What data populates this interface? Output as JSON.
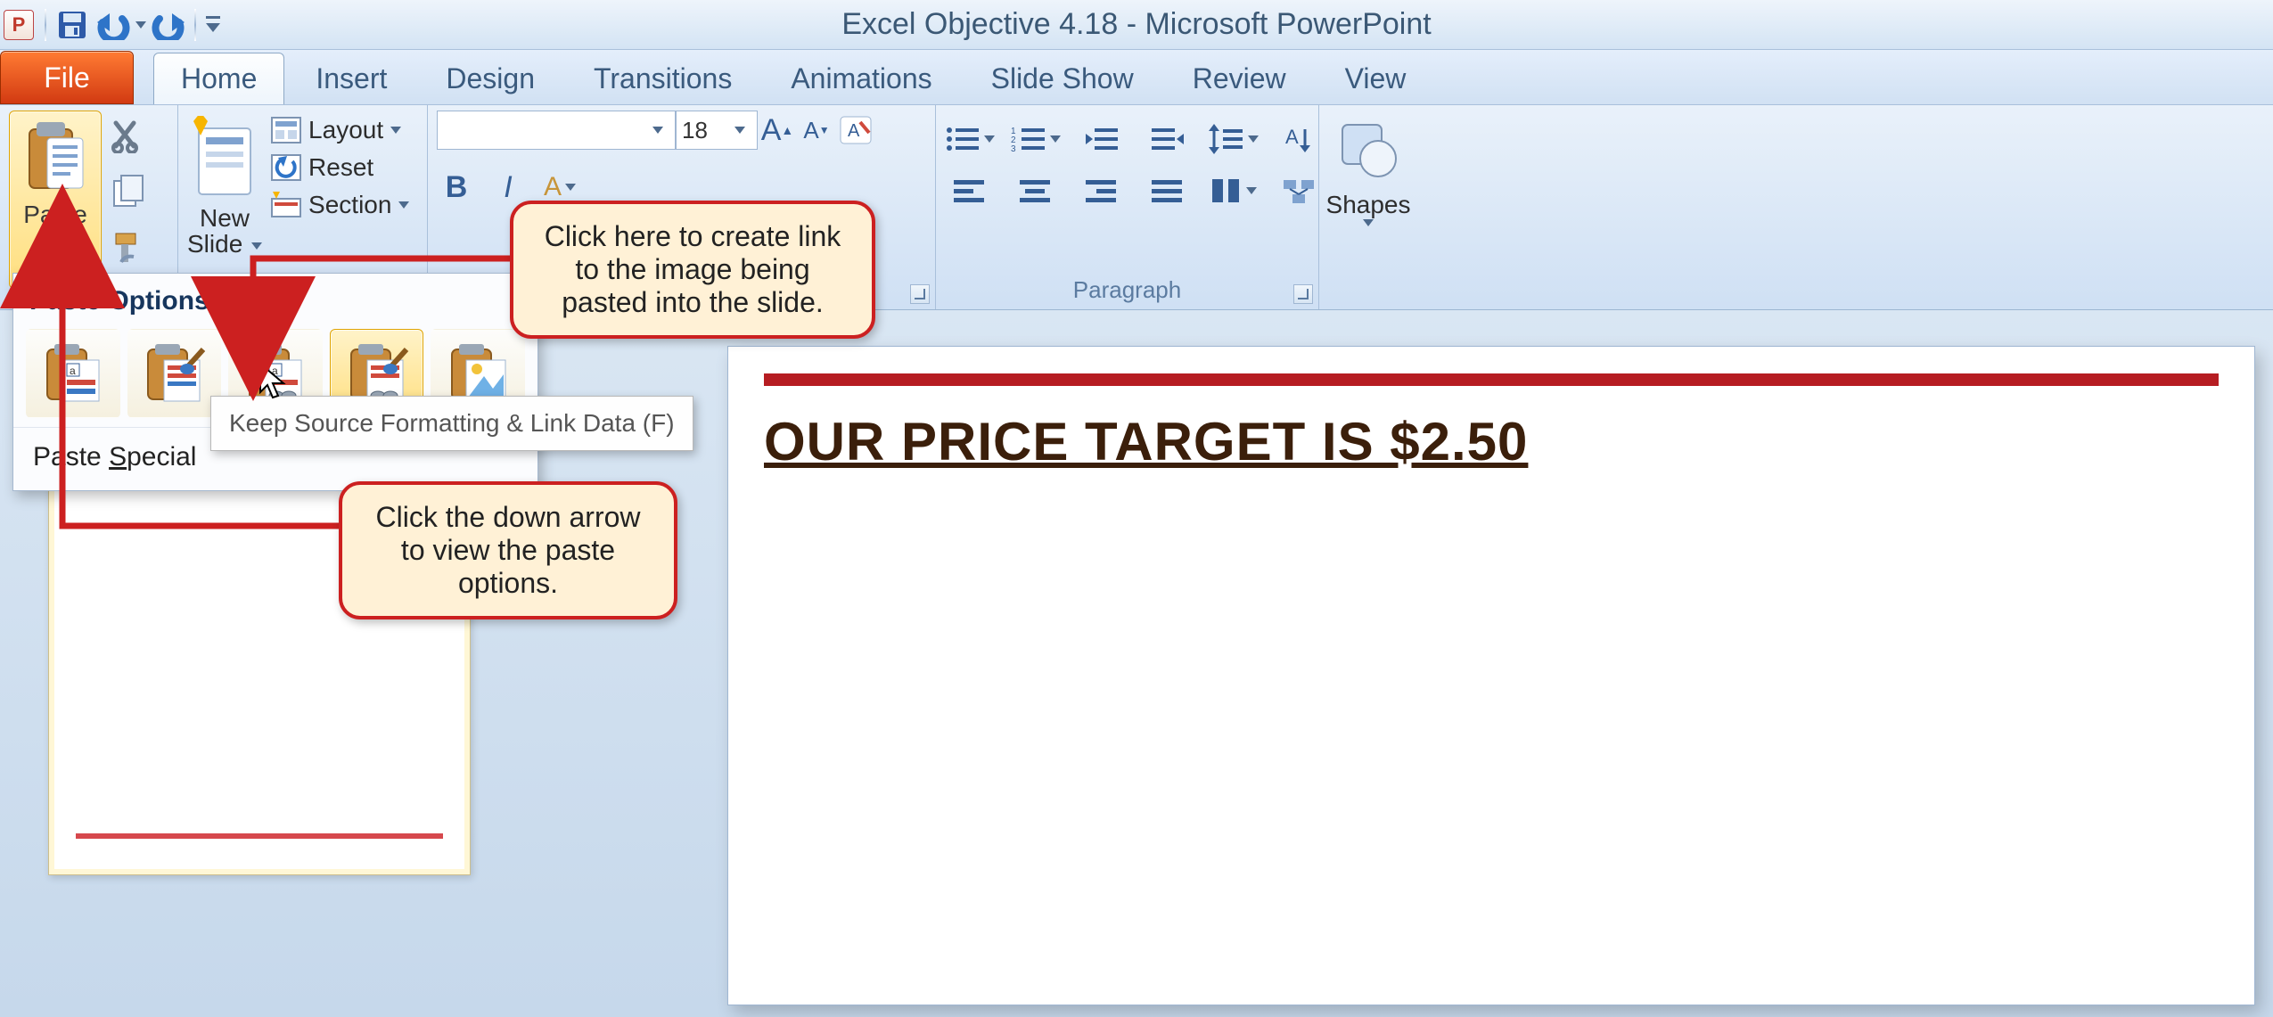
{
  "app": {
    "title": "Excel Objective 4.18  -  Microsoft PowerPoint",
    "letter": "P"
  },
  "tabs": {
    "file": "File",
    "items": [
      "Home",
      "Insert",
      "Design",
      "Transitions",
      "Animations",
      "Slide Show",
      "Review",
      "View"
    ],
    "active": "Home"
  },
  "clipboard": {
    "paste": "Paste"
  },
  "slides": {
    "new_slide": "New",
    "new_slide2": "Slide",
    "layout": "Layout",
    "reset": "Reset",
    "section": "Section"
  },
  "font": {
    "size": "18",
    "bold": "B",
    "italic": "I",
    "grow": "A",
    "shrink": "A",
    "colorA": "A"
  },
  "paragraph": {
    "label": "Paragraph"
  },
  "drawing": {
    "shapes": "Shapes"
  },
  "paste_options": {
    "title": "Paste Options:",
    "special_pre": "Paste ",
    "special_u": "S",
    "special_post": "pecial",
    "tooltip": "Keep Source Formatting & Link Data (F)"
  },
  "callouts": {
    "top": "Click here to create link to the image being pasted into the slide.",
    "bottom": "Click the down arrow to view the paste options."
  },
  "slide": {
    "title": "OUR PRICE TARGET IS $2.50"
  }
}
